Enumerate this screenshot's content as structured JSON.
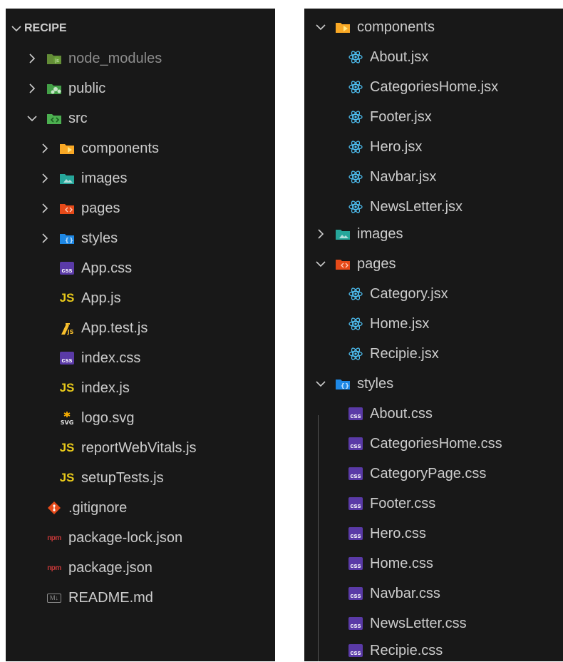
{
  "left": {
    "title": "RECIPE",
    "rows": [
      {
        "label": "node_modules",
        "icon": "node-folder-icon"
      },
      {
        "label": "public",
        "icon": "public-folder-icon"
      },
      {
        "label": "src",
        "icon": "src-folder-icon"
      },
      {
        "label": "components",
        "icon": "components-folder-icon"
      },
      {
        "label": "images",
        "icon": "images-folder-icon"
      },
      {
        "label": "pages",
        "icon": "pages-folder-icon"
      },
      {
        "label": "styles",
        "icon": "styles-folder-icon"
      },
      {
        "label": "App.css",
        "icon": "css-file-icon",
        "icon_text": "css"
      },
      {
        "label": "App.js",
        "icon": "js-file-icon",
        "icon_text": "JS"
      },
      {
        "label": "App.test.js",
        "icon": "test-file-icon"
      },
      {
        "label": "index.css",
        "icon": "css-file-icon",
        "icon_text": "css"
      },
      {
        "label": "index.js",
        "icon": "js-file-icon",
        "icon_text": "JS"
      },
      {
        "label": "logo.svg",
        "icon": "svg-file-icon"
      },
      {
        "label": "reportWebVitals.js",
        "icon": "js-file-icon",
        "icon_text": "JS"
      },
      {
        "label": "setupTests.js",
        "icon": "js-file-icon",
        "icon_text": "JS"
      },
      {
        "label": ".gitignore",
        "icon": "git-file-icon"
      },
      {
        "label": "package-lock.json",
        "icon": "npm-file-icon",
        "icon_text": "npm"
      },
      {
        "label": "package.json",
        "icon": "npm-file-icon",
        "icon_text": "npm"
      },
      {
        "label": "README.md",
        "icon": "markdown-file-icon",
        "icon_text": "M↓"
      }
    ]
  },
  "right": {
    "rows": [
      {
        "label": "components",
        "icon": "components-folder-icon"
      },
      {
        "label": "About.jsx",
        "icon": "react-file-icon"
      },
      {
        "label": "CategoriesHome.jsx",
        "icon": "react-file-icon"
      },
      {
        "label": "Footer.jsx",
        "icon": "react-file-icon"
      },
      {
        "label": "Hero.jsx",
        "icon": "react-file-icon"
      },
      {
        "label": "Navbar.jsx",
        "icon": "react-file-icon"
      },
      {
        "label": "NewsLetter.jsx",
        "icon": "react-file-icon"
      },
      {
        "label": "images",
        "icon": "images-folder-icon"
      },
      {
        "label": "pages",
        "icon": "pages-folder-icon"
      },
      {
        "label": "Category.jsx",
        "icon": "react-file-icon"
      },
      {
        "label": "Home.jsx",
        "icon": "react-file-icon"
      },
      {
        "label": "Recipie.jsx",
        "icon": "react-file-icon"
      },
      {
        "label": "styles",
        "icon": "styles-folder-icon"
      },
      {
        "label": "About.css",
        "icon": "css-file-icon",
        "icon_text": "css"
      },
      {
        "label": "CategoriesHome.css",
        "icon": "css-file-icon",
        "icon_text": "css"
      },
      {
        "label": "CategoryPage.css",
        "icon": "css-file-icon",
        "icon_text": "css"
      },
      {
        "label": "Footer.css",
        "icon": "css-file-icon",
        "icon_text": "css"
      },
      {
        "label": "Hero.css",
        "icon": "css-file-icon",
        "icon_text": "css"
      },
      {
        "label": "Home.css",
        "icon": "css-file-icon",
        "icon_text": "css"
      },
      {
        "label": "Navbar.css",
        "icon": "css-file-icon",
        "icon_text": "css"
      },
      {
        "label": "NewsLetter.css",
        "icon": "css-file-icon",
        "icon_text": "css"
      },
      {
        "label": "Recipie.css",
        "icon": "css-file-icon",
        "icon_text": "css"
      }
    ]
  },
  "colors": {
    "background": "#181818",
    "text": "#cccccc",
    "dim_text": "#8c8c8c",
    "css_badge": "#5a3aa7",
    "js_badge": "#e8c91a",
    "react": "#4fc3f7"
  }
}
